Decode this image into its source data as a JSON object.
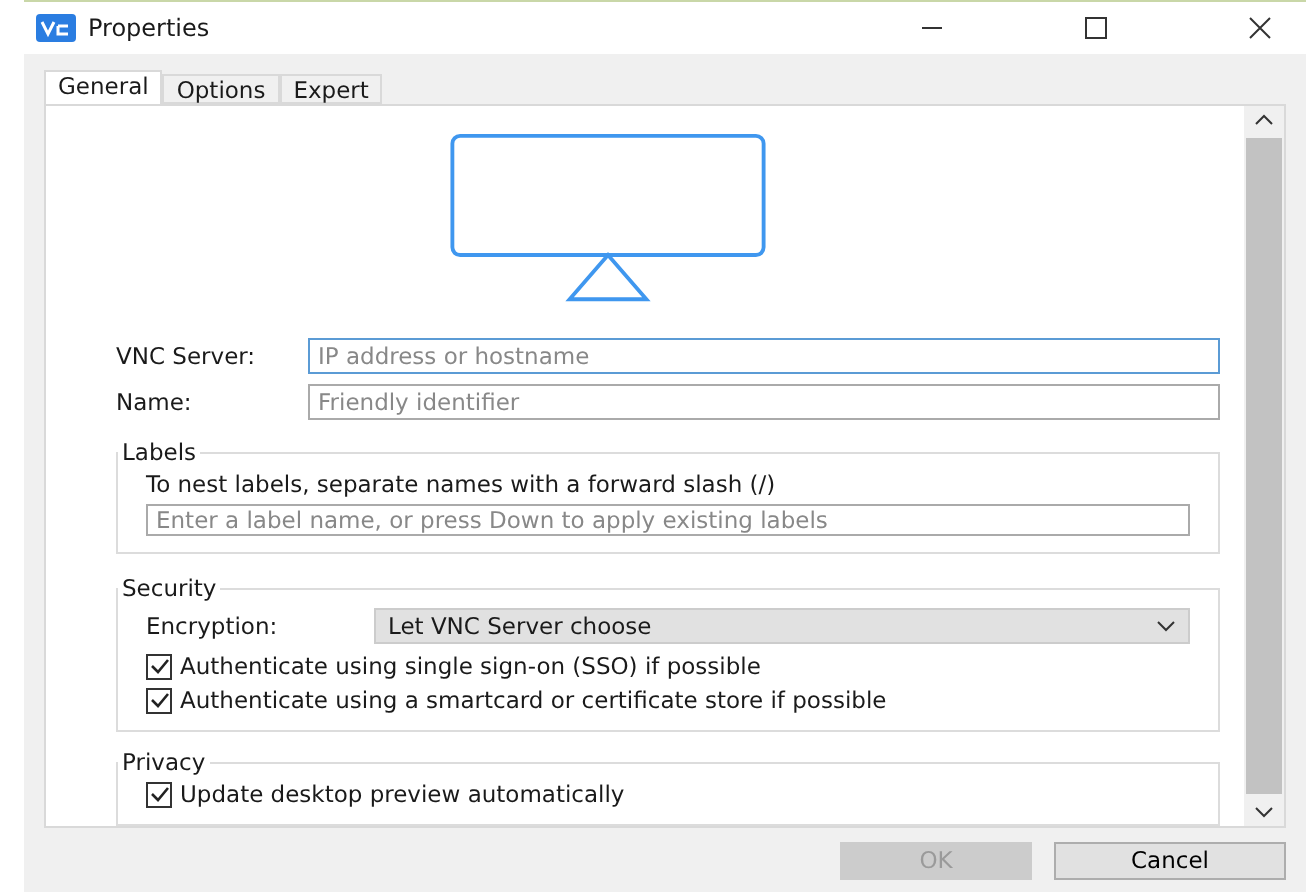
{
  "window": {
    "title": "Properties"
  },
  "tabs": [
    {
      "label": "General",
      "selected": true
    },
    {
      "label": "Options",
      "selected": false
    },
    {
      "label": "Expert",
      "selected": false
    }
  ],
  "fields": [
    {
      "label": "VNC Server:",
      "placeholder": "IP address or hostname",
      "focused": true
    },
    {
      "label": "Name:",
      "placeholder": "Friendly identifier",
      "focused": false
    }
  ],
  "labels_group": {
    "title": "Labels",
    "hint": "To nest labels, separate names with a forward slash (/)",
    "placeholder": "Enter a label name, or press Down to apply existing labels"
  },
  "security_group": {
    "title": "Security",
    "encryption_label": "Encryption:",
    "encryption_value": "Let VNC Server choose",
    "options": [
      {
        "label": "Authenticate using single sign-on (SSO) if possible",
        "checked": true
      },
      {
        "label": "Authenticate using a smartcard or certificate store if possible",
        "checked": true
      }
    ]
  },
  "privacy_group": {
    "title": "Privacy",
    "options": [
      {
        "label": "Update desktop preview automatically",
        "checked": true
      }
    ]
  },
  "buttons": [
    {
      "label": "OK",
      "disabled": true
    },
    {
      "label": "Cancel",
      "disabled": false
    }
  ]
}
